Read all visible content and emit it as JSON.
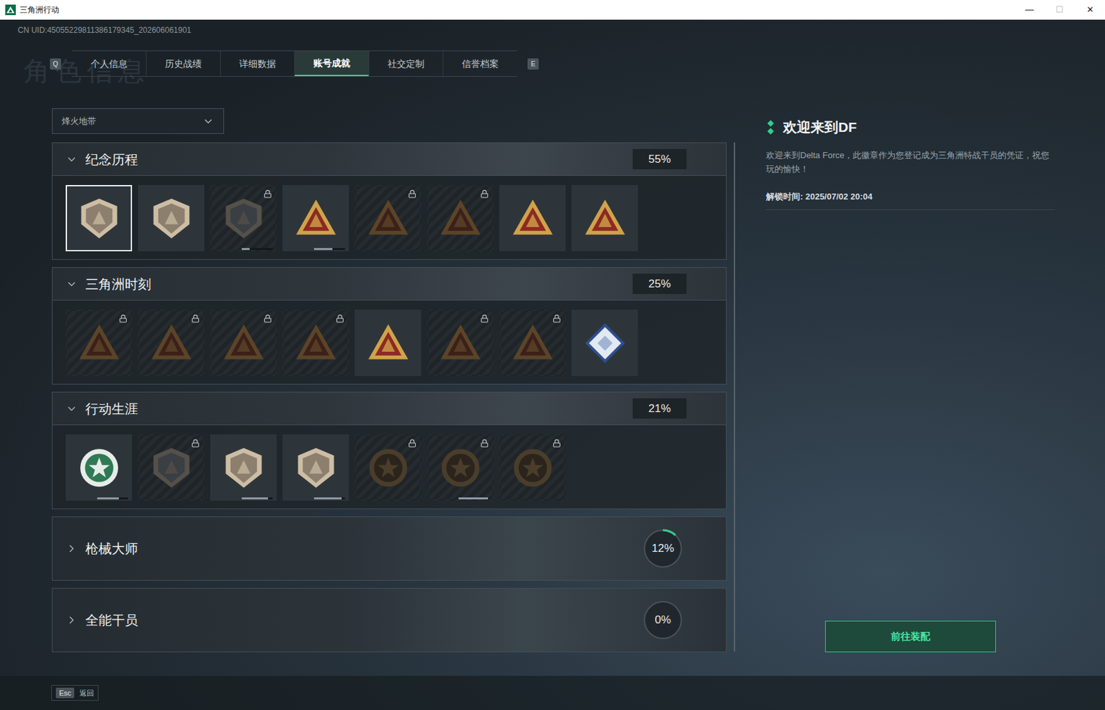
{
  "window": {
    "title": "三角洲行动",
    "controls": [
      "—",
      "☐",
      "✕"
    ]
  },
  "uid": "CN UID:45055229811386179345_202606061901",
  "watermark": "角色信息",
  "tabs": {
    "prev_key": "Q",
    "next_key": "E",
    "items": [
      {
        "label": "个人信息",
        "selected": false
      },
      {
        "label": "历史战绩",
        "selected": false
      },
      {
        "label": "详细数据",
        "selected": false
      },
      {
        "label": "账号成就",
        "selected": true
      },
      {
        "label": "社交定制",
        "selected": false
      },
      {
        "label": "信誉档案",
        "selected": false
      }
    ]
  },
  "mode_select": {
    "value": "烽火地带"
  },
  "sections": [
    {
      "title": "纪念历程",
      "percent": "55%",
      "expanded": true,
      "badges": [
        {
          "kind": "shield",
          "locked": false,
          "selected": true
        },
        {
          "kind": "shield",
          "locked": false,
          "selected": false
        },
        {
          "kind": "shield",
          "locked": true,
          "selected": false,
          "level": 0.25
        },
        {
          "kind": "triangle",
          "locked": false,
          "selected": false,
          "level": 0.6
        },
        {
          "kind": "triangle",
          "locked": true,
          "selected": false
        },
        {
          "kind": "triangle",
          "locked": true,
          "selected": false
        },
        {
          "kind": "triangle",
          "locked": false,
          "selected": false
        },
        {
          "kind": "triangle",
          "locked": false,
          "selected": false
        }
      ]
    },
    {
      "title": "三角洲时刻",
      "percent": "25%",
      "expanded": true,
      "badges": [
        {
          "kind": "triangle",
          "locked": true,
          "selected": false
        },
        {
          "kind": "triangle",
          "locked": true,
          "selected": false
        },
        {
          "kind": "triangle",
          "locked": true,
          "selected": false
        },
        {
          "kind": "triangle",
          "locked": true,
          "selected": false
        },
        {
          "kind": "triangle",
          "locked": false,
          "selected": false
        },
        {
          "kind": "triangle",
          "locked": true,
          "selected": false
        },
        {
          "kind": "triangle",
          "locked": true,
          "selected": false
        },
        {
          "kind": "diamond",
          "locked": false,
          "selected": false
        }
      ]
    },
    {
      "title": "行动生涯",
      "percent": "21%",
      "expanded": true,
      "badges": [
        {
          "kind": "medal",
          "locked": false,
          "selected": false,
          "level": 0.7
        },
        {
          "kind": "shield",
          "locked": true,
          "selected": false
        },
        {
          "kind": "shield",
          "locked": false,
          "selected": false,
          "level": 0.85
        },
        {
          "kind": "shield",
          "locked": false,
          "selected": false,
          "level": 0.9
        },
        {
          "kind": "medal",
          "locked": true,
          "selected": false
        },
        {
          "kind": "medal",
          "locked": true,
          "selected": false,
          "level": 0.95
        },
        {
          "kind": "medal",
          "locked": true,
          "selected": false
        }
      ]
    },
    {
      "title": "枪械大师",
      "percent": "12%",
      "expanded": false,
      "level": 0.12
    },
    {
      "title": "全能干员",
      "percent": "0%",
      "expanded": false,
      "level": 0
    }
  ],
  "detail": {
    "title": "欢迎来到DF",
    "description": "欢迎来到Delta Force，此徽章作为您登记成为三角洲特战干员的凭证，祝您玩的愉快！",
    "unlock_time": "解锁时间: 2025/07/02 20:04",
    "button": "前往装配"
  },
  "footer": {
    "key": "Esc",
    "label": "返回"
  }
}
